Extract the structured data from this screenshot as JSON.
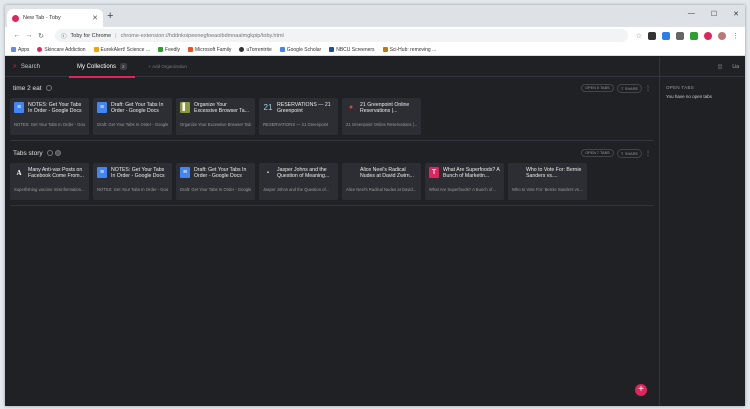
{
  "browser": {
    "tab_title": "New Tab - Toby",
    "site_name": "Toby for Chrome",
    "url": "chrome-extension://hddnkoipeenegfoeaoibdmnaalmgkpip/toby.html",
    "bookmarks": [
      "Apps",
      "Skincare Addiction",
      "EurekAlert! Science ...",
      "Feedly",
      "Microsoft Family",
      "uTorrentrite",
      "Google Scholar",
      "NBCU Screeners",
      "Sci-Hub: removing ..."
    ]
  },
  "toby": {
    "search_label": "Search",
    "my_collections_label": "My Collections",
    "collections_count": "2",
    "add_organization_label": "+ Add Organization",
    "side_top_label": "Lia",
    "open_tabs_header": "OPEN TABS",
    "open_tabs_empty": "You have no open tabs",
    "fab_label": "+"
  },
  "collections": [
    {
      "name": "time 2 eat",
      "open_label": "OPEN 5 TABS",
      "share_label": "SHARE",
      "cards": [
        {
          "title": "NOTES: Get Your Tabs In Order - Google Docs",
          "desc": "NOTES: Get Your Tabs In Order - Google Docs",
          "icon": "google-docs-icon",
          "color": "#4285f4",
          "glyph": "≡"
        },
        {
          "title": "Draft: Get Your Tabs In Order - Google Docs",
          "desc": "Draft: Get Your Tabs In Order - Google Docs",
          "icon": "google-docs-icon",
          "color": "#4285f4",
          "glyph": "≡"
        },
        {
          "title": "Organize Your Excessive Browser Ta...",
          "desc": "Organize Your Excessive Browser Tabs...",
          "icon": "leaf-icon",
          "color": "#8a9a3a",
          "glyph": "▌"
        },
        {
          "title": "RESERVATIONS — 21 Greenpoint",
          "desc": "RESERVATIONS — 21 Greenpoint",
          "icon": "number-21-icon",
          "color": "#2d2e33",
          "glyph": "21"
        },
        {
          "title": "21 Greenpoint Online Reservations |...",
          "desc": "21 Greenpoint Online Reservations |...",
          "icon": "reservation-icon",
          "color": "#c0392b",
          "glyph": "●"
        }
      ]
    },
    {
      "name": "Tabs story",
      "open_label": "OPEN 7 TABS",
      "share_label": "SHARE",
      "cards": [
        {
          "title": "Many Anti-vax Posts on Facebook Come From...",
          "desc": "Superfishing vaccine misinformation...",
          "icon": "atlantic-icon",
          "color": "#ffffff",
          "glyph": "A"
        },
        {
          "title": "NOTES: Get Your Tabs In Order - Google Docs",
          "desc": "NOTES: Get Your Tabs In Order - Google Docs",
          "icon": "google-docs-icon",
          "color": "#4285f4",
          "glyph": "≡"
        },
        {
          "title": "Draft: Get Your Tabs In Order - Google Docs",
          "desc": "Draft: Get Your Tabs In Order - Google Docs",
          "icon": "google-docs-icon",
          "color": "#4285f4",
          "glyph": "≡"
        },
        {
          "title": "Jasper Johns and the Question of Meaning...",
          "desc": "Jasper Johns and the Question of...",
          "icon": "page-icon",
          "color": "#2d2e33",
          "glyph": "▪"
        },
        {
          "title": "Alice Neel's Radical Nudes at David Zwirn...",
          "desc": "Alice Neel's Radical Nudes at David...",
          "icon": "blank-icon",
          "color": "#2d2e33",
          "glyph": ""
        },
        {
          "title": "What Are Superfoods? A Bunch of Marketin...",
          "desc": "What Are Superfoods? A Bunch of...",
          "icon": "t-icon",
          "color": "#e0245e",
          "glyph": "T"
        },
        {
          "title": "Who to Vote For: Bernie Sanders vs....",
          "desc": "Who to Vote For: Bernie Sanders vs....",
          "icon": "blank-icon",
          "color": "#2d2e33",
          "glyph": ""
        }
      ]
    }
  ]
}
